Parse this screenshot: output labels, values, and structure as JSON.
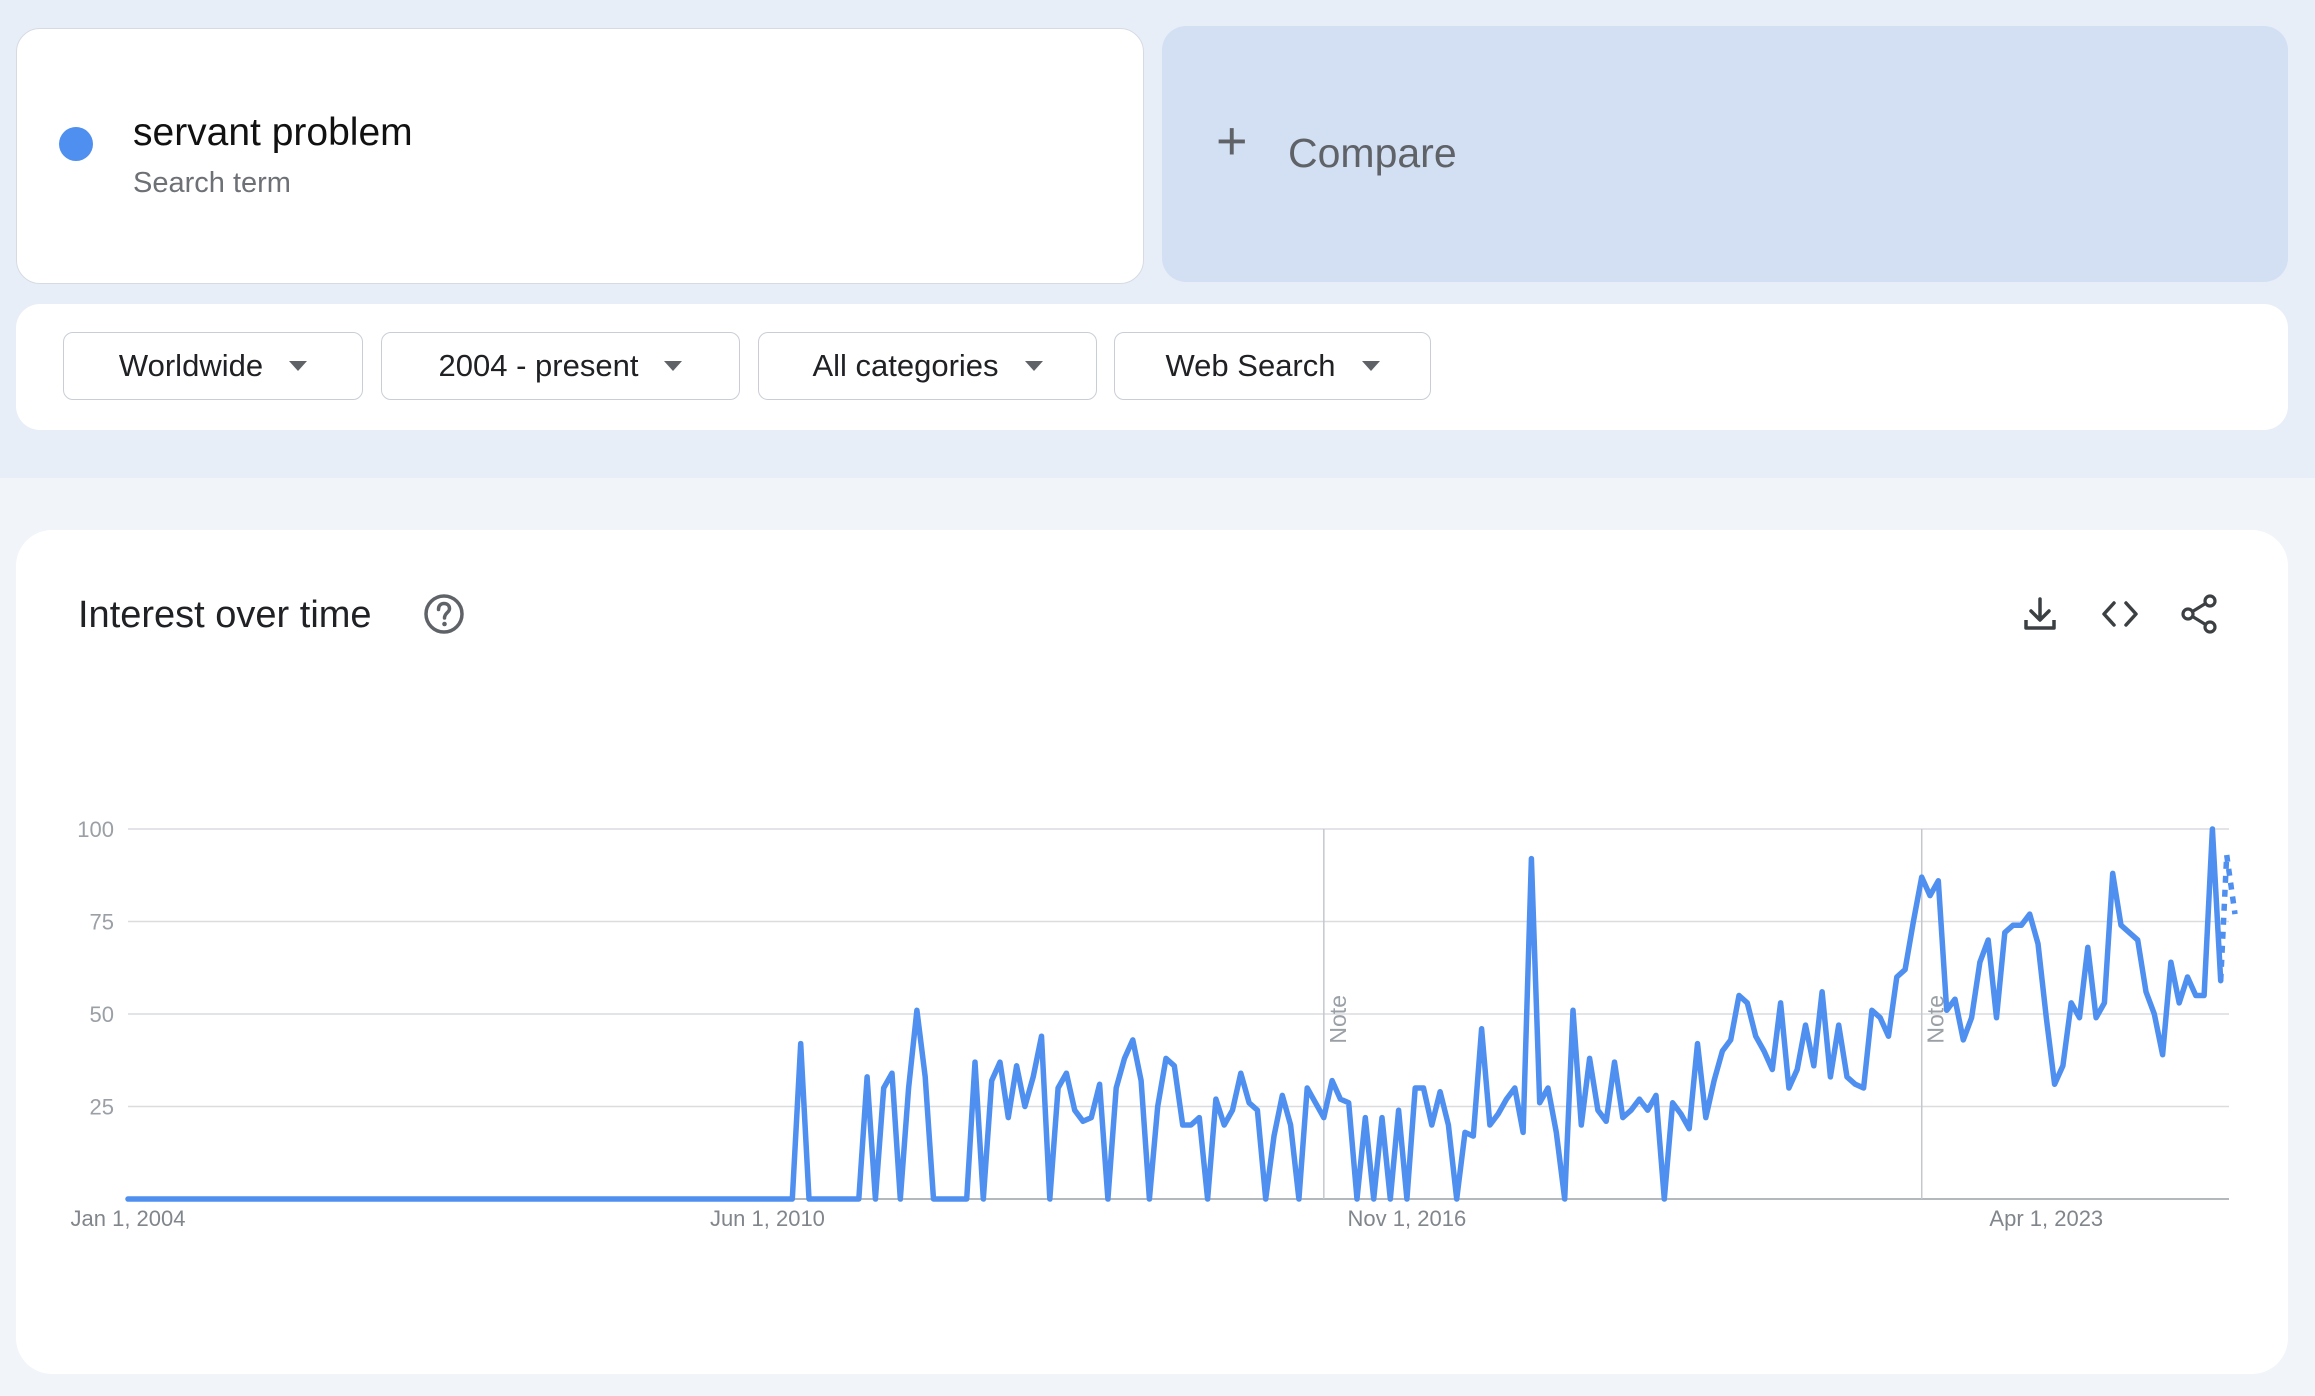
{
  "search_term": {
    "name": "servant problem",
    "type_label": "Search term",
    "color": "#4f8ff0"
  },
  "compare": {
    "label": "Compare",
    "icon": "plus-icon"
  },
  "filters": {
    "region": "Worldwide",
    "time_range": "2004 - present",
    "category": "All categories",
    "search_type": "Web Search"
  },
  "panel": {
    "title": "Interest over time",
    "icons": [
      "help-circle-icon",
      "download-icon",
      "embed-code-icon",
      "share-icon"
    ]
  },
  "chart_data": {
    "type": "line",
    "title": "Interest over time",
    "ylim": [
      0,
      100
    ],
    "y_ticks": [
      "100",
      "75",
      "50",
      "25"
    ],
    "x_tick_labels": [
      "Jan 1, 2004",
      "Jun 1, 2010",
      "Nov 1, 2016",
      "Apr 1, 2023"
    ],
    "x_range": [
      "2004-01",
      "2025-02"
    ],
    "x_ticks": [
      "2004-01",
      "2010-06",
      "2016-11",
      "2023-04"
    ],
    "annotations": [
      {
        "label": "Note",
        "date": "2016-01"
      },
      {
        "label": "Note",
        "date": "2022-01"
      }
    ],
    "grid": true,
    "series": [
      {
        "name": "servant problem",
        "color": "#4f8ff0",
        "points": [
          [
            "2004-01",
            0
          ],
          [
            "2010-09",
            0
          ],
          [
            "2010-10",
            42
          ],
          [
            "2010-11",
            0
          ],
          [
            "2011-05",
            0
          ],
          [
            "2011-06",
            33
          ],
          [
            "2011-07",
            0
          ],
          [
            "2011-08",
            30
          ],
          [
            "2011-09",
            34
          ],
          [
            "2011-10",
            0
          ],
          [
            "2011-11",
            30
          ],
          [
            "2011-12",
            51
          ],
          [
            "2012-01",
            33
          ],
          [
            "2012-02",
            0
          ],
          [
            "2012-06",
            0
          ],
          [
            "2012-07",
            37
          ],
          [
            "2012-08",
            0
          ],
          [
            "2012-09",
            32
          ],
          [
            "2012-10",
            37
          ],
          [
            "2012-11",
            22
          ],
          [
            "2012-12",
            36
          ],
          [
            "2013-01",
            25
          ],
          [
            "2013-02",
            33
          ],
          [
            "2013-03",
            44
          ],
          [
            "2013-04",
            0
          ],
          [
            "2013-05",
            30
          ],
          [
            "2013-06",
            34
          ],
          [
            "2013-07",
            24
          ],
          [
            "2013-08",
            21
          ],
          [
            "2013-09",
            22
          ],
          [
            "2013-10",
            31
          ],
          [
            "2013-11",
            0
          ],
          [
            "2013-12",
            30
          ],
          [
            "2014-01",
            38
          ],
          [
            "2014-02",
            43
          ],
          [
            "2014-03",
            32
          ],
          [
            "2014-04",
            0
          ],
          [
            "2014-05",
            25
          ],
          [
            "2014-06",
            38
          ],
          [
            "2014-07",
            36
          ],
          [
            "2014-08",
            20
          ],
          [
            "2014-09",
            20
          ],
          [
            "2014-10",
            22
          ],
          [
            "2014-11",
            0
          ],
          [
            "2014-12",
            27
          ],
          [
            "2015-01",
            20
          ],
          [
            "2015-02",
            24
          ],
          [
            "2015-03",
            34
          ],
          [
            "2015-04",
            26
          ],
          [
            "2015-05",
            24
          ],
          [
            "2015-06",
            0
          ],
          [
            "2015-07",
            17
          ],
          [
            "2015-08",
            28
          ],
          [
            "2015-09",
            20
          ],
          [
            "2015-10",
            0
          ],
          [
            "2015-11",
            30
          ],
          [
            "2015-12",
            26
          ],
          [
            "2016-01",
            22
          ],
          [
            "2016-02",
            32
          ],
          [
            "2016-03",
            27
          ],
          [
            "2016-04",
            26
          ],
          [
            "2016-05",
            0
          ],
          [
            "2016-06",
            22
          ],
          [
            "2016-07",
            0
          ],
          [
            "2016-08",
            22
          ],
          [
            "2016-09",
            0
          ],
          [
            "2016-10",
            24
          ],
          [
            "2016-11",
            0
          ],
          [
            "2016-12",
            30
          ],
          [
            "2017-01",
            30
          ],
          [
            "2017-02",
            20
          ],
          [
            "2017-03",
            29
          ],
          [
            "2017-04",
            20
          ],
          [
            "2017-05",
            0
          ],
          [
            "2017-06",
            18
          ],
          [
            "2017-07",
            17
          ],
          [
            "2017-08",
            46
          ],
          [
            "2017-09",
            20
          ],
          [
            "2017-10",
            23
          ],
          [
            "2017-11",
            27
          ],
          [
            "2017-12",
            30
          ],
          [
            "2018-01",
            18
          ],
          [
            "2018-02",
            92
          ],
          [
            "2018-03",
            26
          ],
          [
            "2018-04",
            30
          ],
          [
            "2018-05",
            18
          ],
          [
            "2018-06",
            0
          ],
          [
            "2018-07",
            51
          ],
          [
            "2018-08",
            20
          ],
          [
            "2018-09",
            38
          ],
          [
            "2018-10",
            24
          ],
          [
            "2018-11",
            21
          ],
          [
            "2018-12",
            37
          ],
          [
            "2019-01",
            22
          ],
          [
            "2019-02",
            24
          ],
          [
            "2019-03",
            27
          ],
          [
            "2019-04",
            24
          ],
          [
            "2019-05",
            28
          ],
          [
            "2019-06",
            0
          ],
          [
            "2019-07",
            26
          ],
          [
            "2019-08",
            23
          ],
          [
            "2019-09",
            19
          ],
          [
            "2019-10",
            42
          ],
          [
            "2019-11",
            22
          ],
          [
            "2019-12",
            32
          ],
          [
            "2020-01",
            40
          ],
          [
            "2020-02",
            43
          ],
          [
            "2020-03",
            55
          ],
          [
            "2020-04",
            53
          ],
          [
            "2020-05",
            44
          ],
          [
            "2020-06",
            40
          ],
          [
            "2020-07",
            35
          ],
          [
            "2020-08",
            53
          ],
          [
            "2020-09",
            30
          ],
          [
            "2020-10",
            35
          ],
          [
            "2020-11",
            47
          ],
          [
            "2020-12",
            36
          ],
          [
            "2021-01",
            56
          ],
          [
            "2021-02",
            33
          ],
          [
            "2021-03",
            47
          ],
          [
            "2021-04",
            33
          ],
          [
            "2021-05",
            31
          ],
          [
            "2021-06",
            30
          ],
          [
            "2021-07",
            51
          ],
          [
            "2021-08",
            49
          ],
          [
            "2021-09",
            44
          ],
          [
            "2021-10",
            60
          ],
          [
            "2021-11",
            62
          ],
          [
            "2021-12",
            75
          ],
          [
            "2022-01",
            87
          ],
          [
            "2022-02",
            82
          ],
          [
            "2022-03",
            86
          ],
          [
            "2022-04",
            51
          ],
          [
            "2022-05",
            54
          ],
          [
            "2022-06",
            43
          ],
          [
            "2022-07",
            49
          ],
          [
            "2022-08",
            64
          ],
          [
            "2022-09",
            70
          ],
          [
            "2022-10",
            49
          ],
          [
            "2022-11",
            72
          ],
          [
            "2022-12",
            74
          ],
          [
            "2023-01",
            74
          ],
          [
            "2023-02",
            77
          ],
          [
            "2023-03",
            69
          ],
          [
            "2023-04",
            49
          ],
          [
            "2023-05",
            31
          ],
          [
            "2023-06",
            36
          ],
          [
            "2023-07",
            53
          ],
          [
            "2023-08",
            49
          ],
          [
            "2023-09",
            68
          ],
          [
            "2023-10",
            49
          ],
          [
            "2023-11",
            53
          ],
          [
            "2023-12",
            88
          ],
          [
            "2024-01",
            74
          ],
          [
            "2024-02",
            72
          ],
          [
            "2024-03",
            70
          ],
          [
            "2024-04",
            56
          ],
          [
            "2024-05",
            50
          ],
          [
            "2024-06",
            39
          ],
          [
            "2024-07",
            64
          ],
          [
            "2024-08",
            53
          ],
          [
            "2024-09",
            60
          ],
          [
            "2024-10",
            55
          ],
          [
            "2024-11",
            55
          ],
          [
            "2024-12",
            100
          ],
          [
            "2025-01",
            59
          ]
        ],
        "partial_points": [
          [
            "2025-01",
            59
          ],
          [
            "2025-01",
            93
          ],
          [
            "2025-02",
            77
          ]
        ]
      }
    ]
  }
}
